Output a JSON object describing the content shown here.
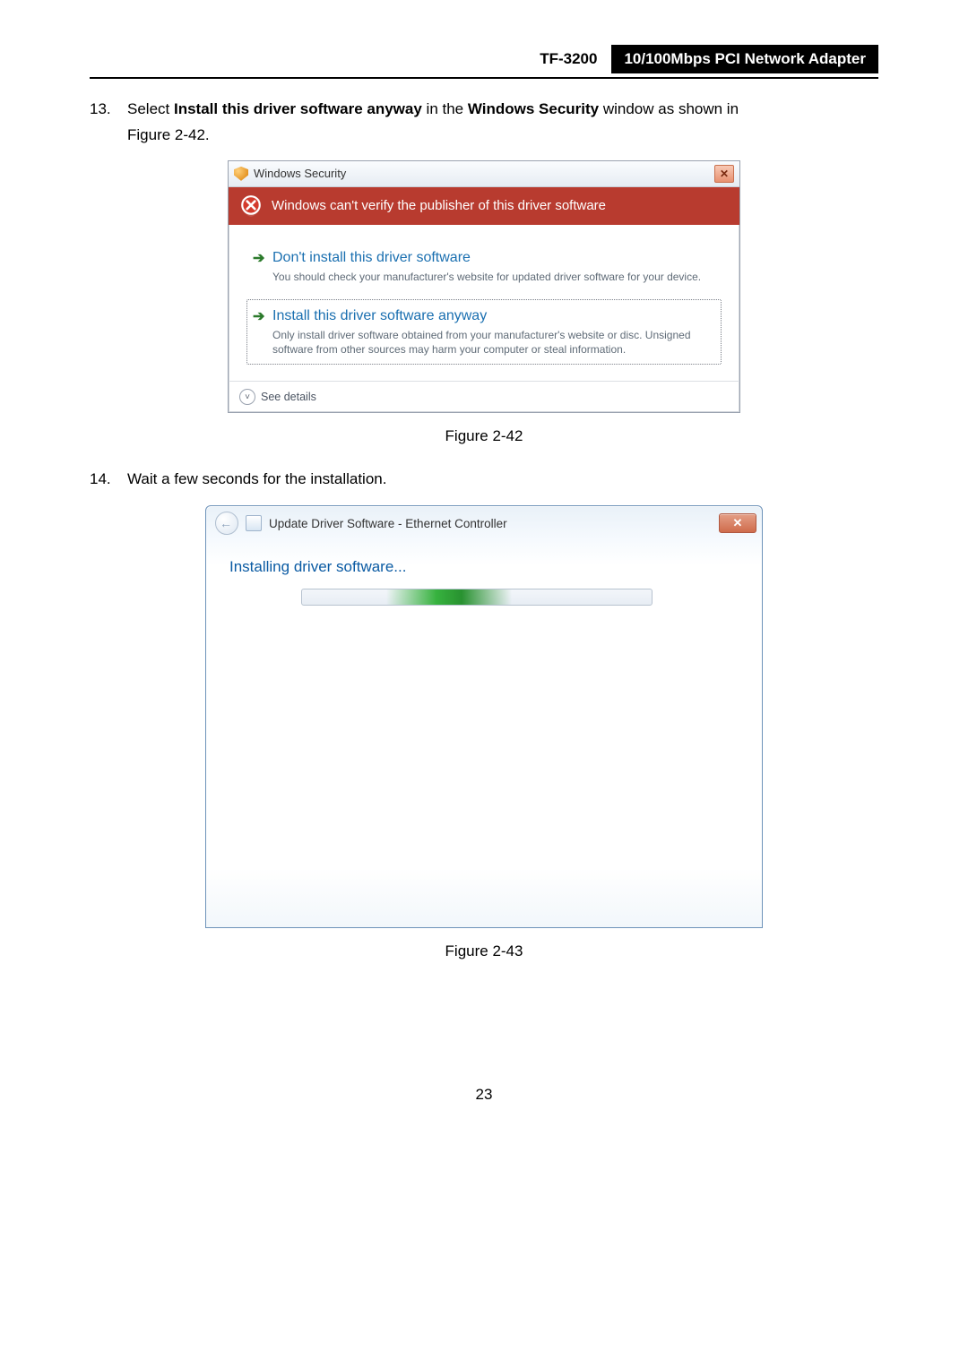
{
  "header": {
    "model": "TF-3200",
    "product": "10/100Mbps PCI Network Adapter"
  },
  "step13": {
    "number": "13.",
    "text_before": "Select ",
    "bold1": "Install this driver software anyway",
    "text_mid": " in the ",
    "bold2": "Windows Security",
    "text_after": " window as shown in",
    "line2": "Figure 2-42."
  },
  "dlg1": {
    "title": "Windows Security",
    "banner": "Windows can't verify the publisher of this driver software",
    "opt1": {
      "title": "Don't install this driver software",
      "desc": "You should check your manufacturer's website for updated driver software for your device."
    },
    "opt2": {
      "title": "Install this driver software anyway",
      "desc": "Only install driver software obtained from your manufacturer's website or disc. Unsigned software from other sources may harm your computer or steal information."
    },
    "see_details": "See details"
  },
  "fig42": "Figure 2-42",
  "step14": {
    "number": "14.",
    "text": "Wait a few seconds for the installation."
  },
  "dlg2": {
    "breadcrumb": "Update Driver Software - Ethernet Controller",
    "heading": "Installing driver software..."
  },
  "fig43": "Figure 2-43",
  "page_number": "23"
}
